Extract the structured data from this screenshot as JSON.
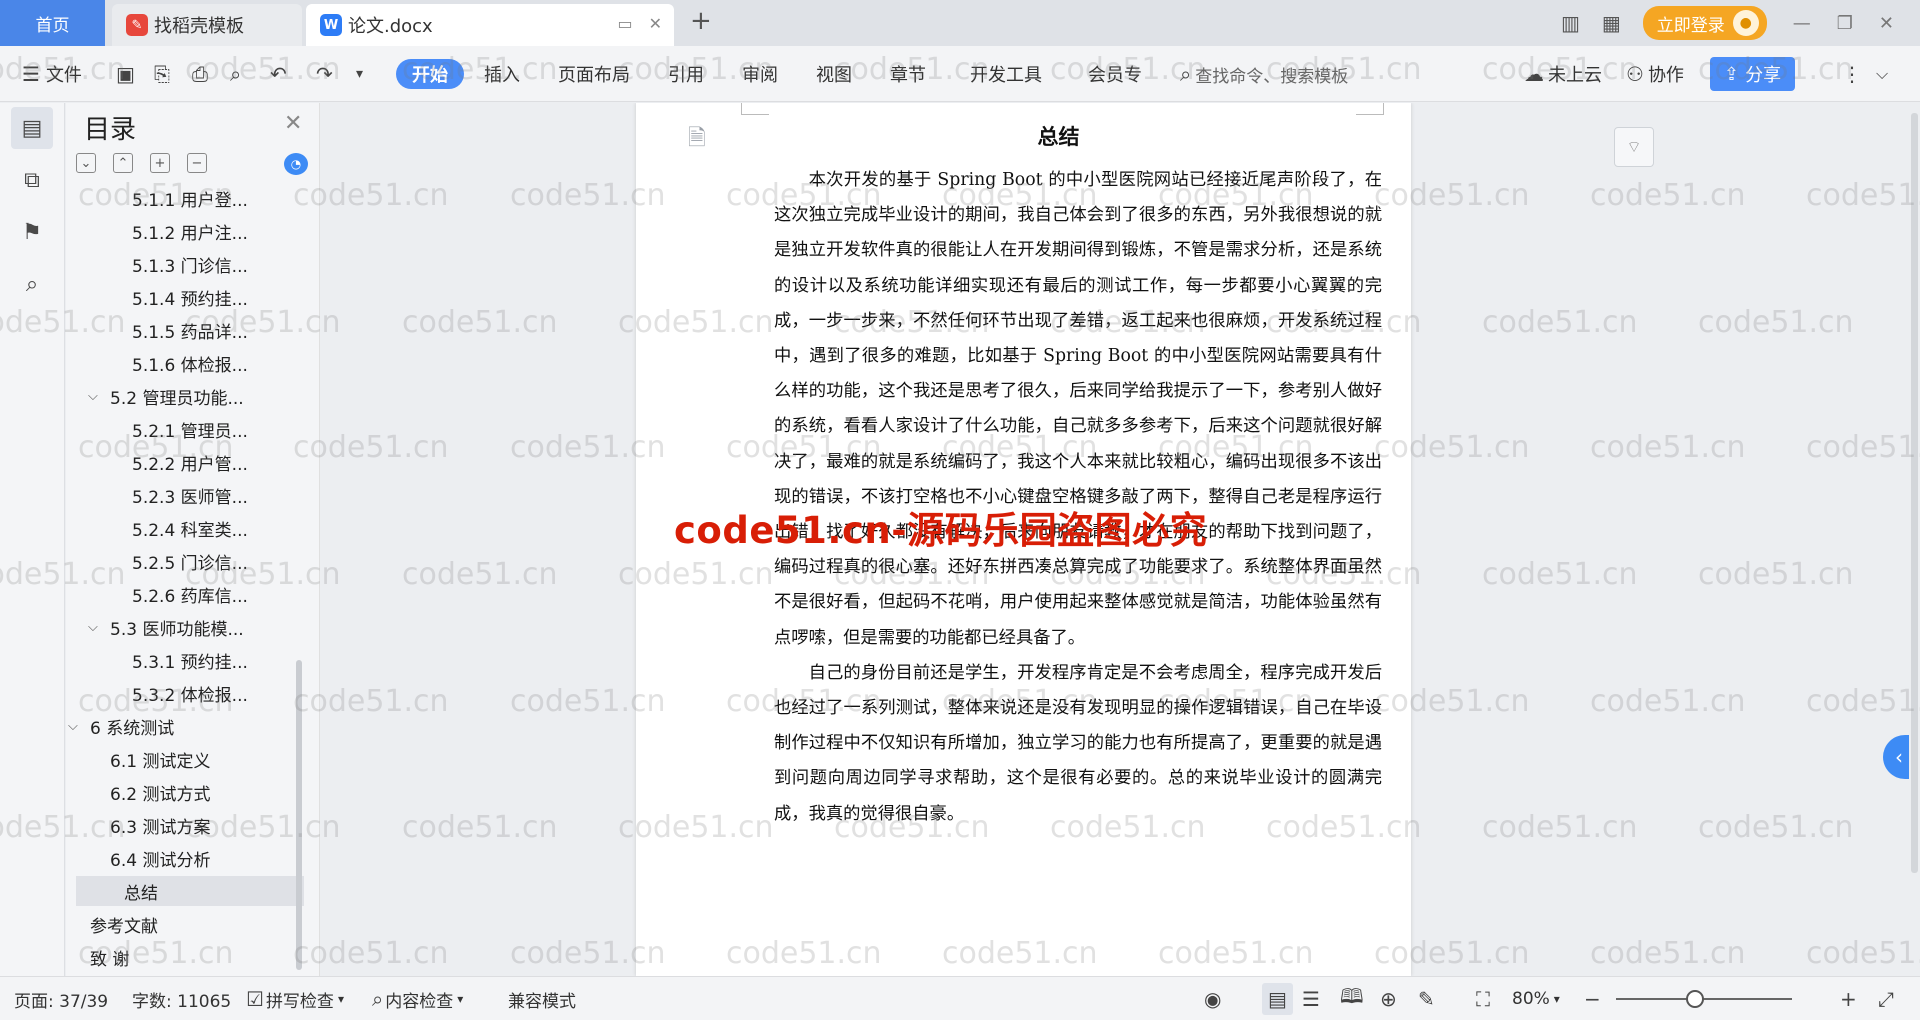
{
  "titlebar": {
    "home_tab": "首页",
    "tabs": [
      {
        "label": "找稻壳模板",
        "icon": "daoke-icon"
      },
      {
        "label": "论文.docx",
        "icon": "wps-writer-icon"
      }
    ],
    "login_label": "立即登录"
  },
  "ribbon": {
    "file_menu": "文件",
    "menu_tabs": [
      "开始",
      "插入",
      "页面布局",
      "引用",
      "审阅",
      "视图",
      "章节",
      "开发工具",
      "会员专"
    ],
    "search_placeholder": "查找命令、搜索模板",
    "cloud_label": "未上云",
    "collab_label": "协作",
    "share_label": "分享"
  },
  "toc": {
    "title": "目录",
    "items": [
      {
        "label": "5.1.1 用户登...",
        "level": 3
      },
      {
        "label": "5.1.2 用户注...",
        "level": 3
      },
      {
        "label": "5.1.3 门诊信...",
        "level": 3
      },
      {
        "label": "5.1.4 预约挂...",
        "level": 3
      },
      {
        "label": "5.1.5 药品详...",
        "level": 3
      },
      {
        "label": "5.1.6 体检报...",
        "level": 3
      },
      {
        "label": "5.2  管理员功能...",
        "level": 2,
        "expanded": true
      },
      {
        "label": "5.2.1 管理员...",
        "level": 3
      },
      {
        "label": "5.2.2 用户管...",
        "level": 3
      },
      {
        "label": "5.2.3 医师管...",
        "level": 3
      },
      {
        "label": "5.2.4 科室类...",
        "level": 3
      },
      {
        "label": "5.2.5 门诊信...",
        "level": 3
      },
      {
        "label": "5.2.6 药库信...",
        "level": 3
      },
      {
        "label": "5.3  医师功能模...",
        "level": 2,
        "expanded": true
      },
      {
        "label": "5.3.1 预约挂...",
        "level": 3
      },
      {
        "label": "5.3.2 体检报...",
        "level": 3
      },
      {
        "label": "6  系统测试",
        "level": 1,
        "expanded": true
      },
      {
        "label": "6.1  测试定义",
        "level": 2
      },
      {
        "label": "6.2  测试方式",
        "level": 2
      },
      {
        "label": "6.3  测试方案",
        "level": 2
      },
      {
        "label": "6.4  测试分析",
        "level": 2
      },
      {
        "label": "总结",
        "level": 2,
        "active": true
      },
      {
        "label": "参考文献",
        "level": 1
      },
      {
        "label": "致    谢",
        "level": 1
      }
    ]
  },
  "document": {
    "heading": "总结",
    "paragraphs": [
      "本次开发的基于 Spring Boot 的中小型医院网站已经接近尾声阶段了，在这次独立完成毕业设计的期间，我自己体会到了很多的东西，另外我很想说的就是独立开发软件真的很能让人在开发期间得到锻炼，不管是需求分析，还是系统的设计以及系统功能详细实现还有最后的测试工作，每一步都要小心翼翼的完成，一步一步来，不然任何环节出现了差错，返工起来也很麻烦，开发系统过程中，遇到了很多的难题，比如基于 Spring Boot 的中小型医院网站需要具有什么样的功能，这个我还是思考了很久，后来同学给我提示了一下，参考别人做好的系统，看看人家设计了什么功能，自己就多多参考下，后来这个问题就很好解决了，最难的就是系统编码了，我这个人本来就比较粗心，编码出现很多不该出现的错误，不该打空格也不小心键盘空格键多敲了两下，整得自己老是程序运行出错，找了好久都没有解决，后来向朋友请教，才在朋友的帮助下找到问题了，编码过程真的很心塞。还好东拼西凑总算完成了功能要求了。系统整体界面虽然不是很好看，但起码不花哨，用户使用起来整体感觉就是简洁，功能体验虽然有点啰嗦，但是需要的功能都已经具备了。",
      "自己的身份目前还是学生，开发程序肯定是不会考虑周全，程序完成开发后也经过了一系列测试，整体来说还是没有发现明显的操作逻辑错误，自己在毕设制作过程中不仅知识有所增加，独立学习的能力也有所提高了，更重要的就是遇到问题向周边同学寻求帮助，这个是很有必要的。总的来说毕业设计的圆满完成，我真的觉得很自豪。"
    ]
  },
  "watermark": {
    "text": "code51.cn",
    "overlay": "code51.cn-源码乐园盗图必究"
  },
  "statusbar": {
    "page": "页面: 37/39",
    "word_count": "字数: 11065",
    "spell_check": "拼写检查",
    "content_check": "内容检查",
    "compat_mode": "兼容模式",
    "zoom": "80%"
  },
  "colors": {
    "accent": "#4b8df8",
    "home_tab": "#4a86e8",
    "login": "#f5a623",
    "watermark_red": "#d81e06"
  }
}
